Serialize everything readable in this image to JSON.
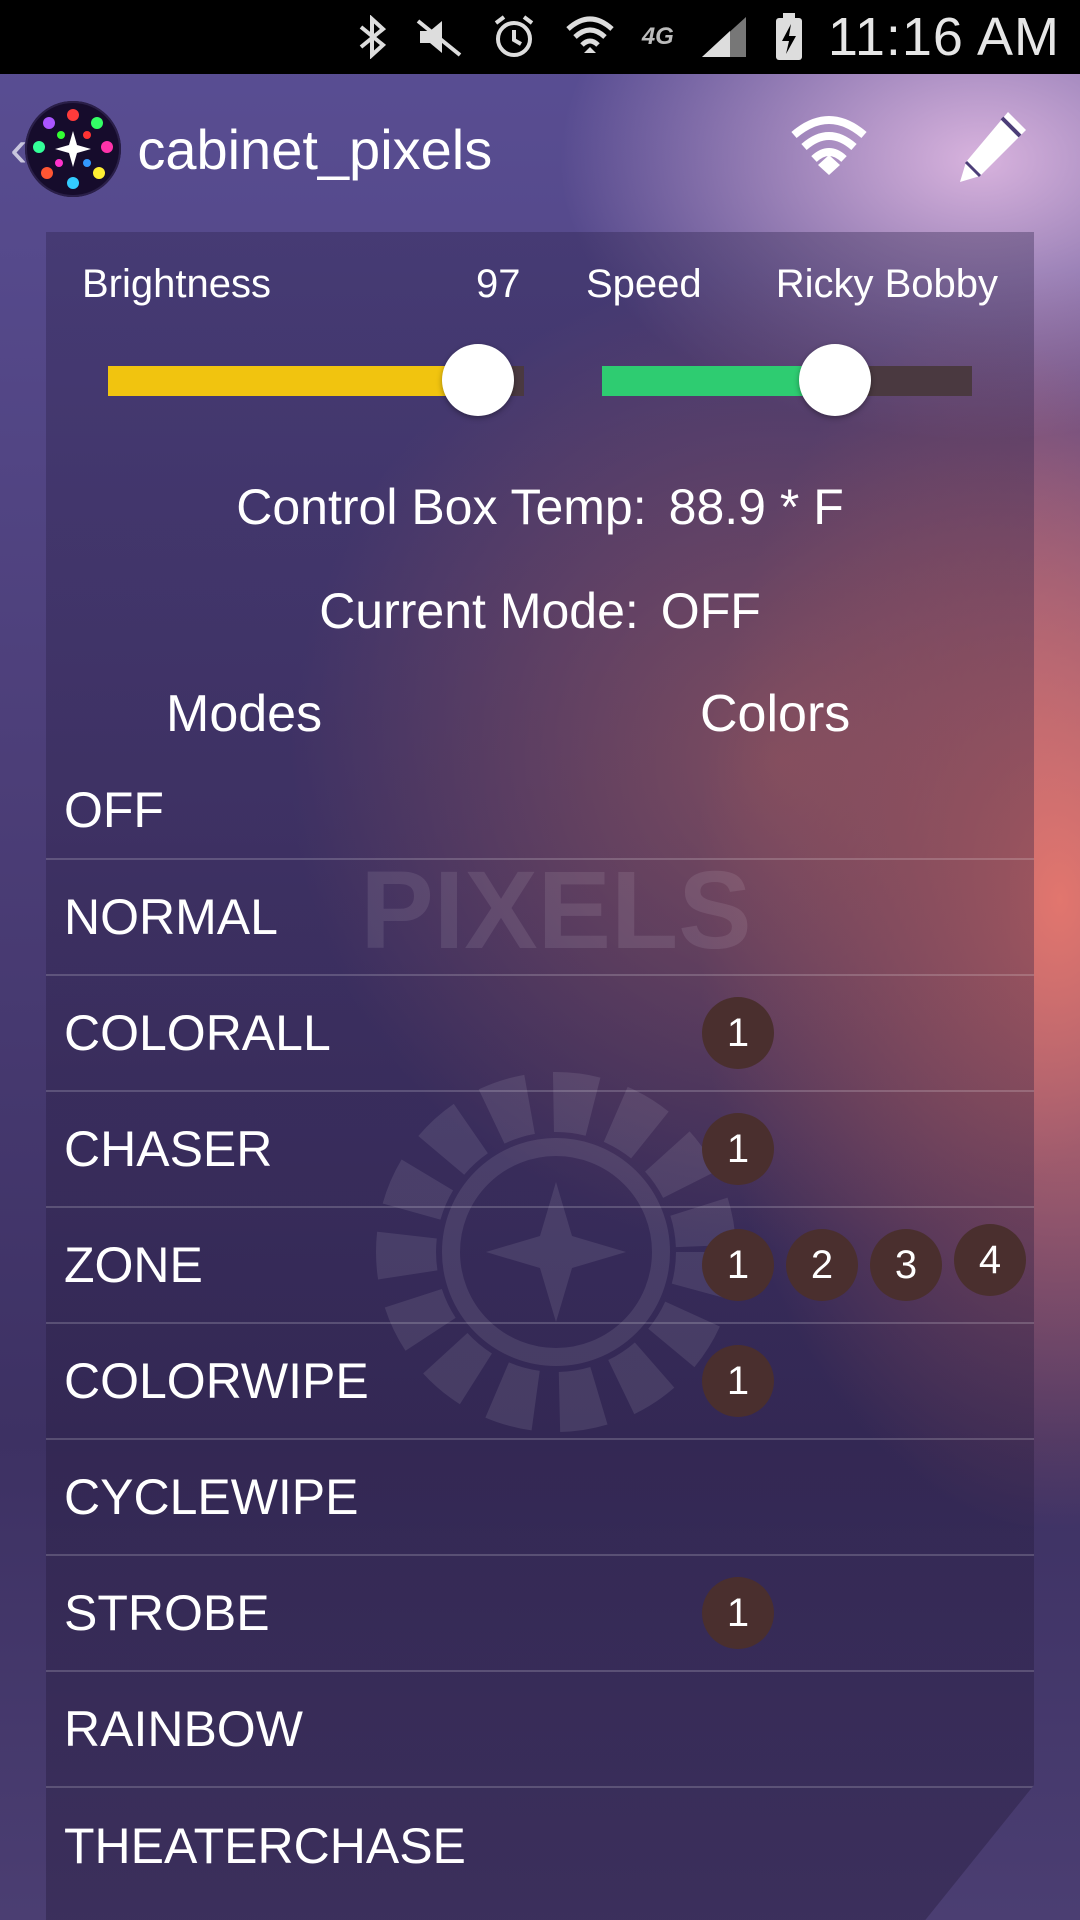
{
  "status_bar": {
    "time": "11:16 AM",
    "network": "4G",
    "icons": [
      "bluetooth-icon",
      "mute-icon",
      "alarm-icon",
      "wifi-icon",
      "4g-lte-icon",
      "signal-icon",
      "battery-charging-icon"
    ]
  },
  "app_bar": {
    "title": "cabinet_pixels",
    "actions": [
      "wifi-icon",
      "edit-pencil-icon"
    ]
  },
  "controls": {
    "brightness_label": "Brightness",
    "brightness_value": "97",
    "brightness_level": 0.89,
    "speed_label": "Speed",
    "speed_value": "Ricky Bobby",
    "speed_level": 0.63
  },
  "status": {
    "temp_label": "Control Box Temp:",
    "temp_value": "88.9 * F",
    "mode_label": "Current Mode:",
    "mode_value": "OFF"
  },
  "columns": {
    "modes": "Modes",
    "colors": "Colors"
  },
  "modes": [
    {
      "name": "OFF",
      "colors": []
    },
    {
      "name": "NORMAL",
      "colors": []
    },
    {
      "name": "COLORALL",
      "colors": [
        "1"
      ]
    },
    {
      "name": "CHASER",
      "colors": [
        "1"
      ]
    },
    {
      "name": "ZONE",
      "colors": [
        "1",
        "2",
        "3",
        "4"
      ]
    },
    {
      "name": "COLORWIPE",
      "colors": [
        "1"
      ]
    },
    {
      "name": "CYCLEWIPE",
      "colors": []
    },
    {
      "name": "STROBE",
      "colors": [
        "1"
      ]
    },
    {
      "name": "RAINBOW",
      "colors": []
    },
    {
      "name": "THEATERCHASE",
      "colors": []
    }
  ],
  "colors": {
    "brightness_fill": "#f1c40f",
    "speed_fill": "#2ecc71",
    "chip_bg": "#4a2f2e"
  }
}
